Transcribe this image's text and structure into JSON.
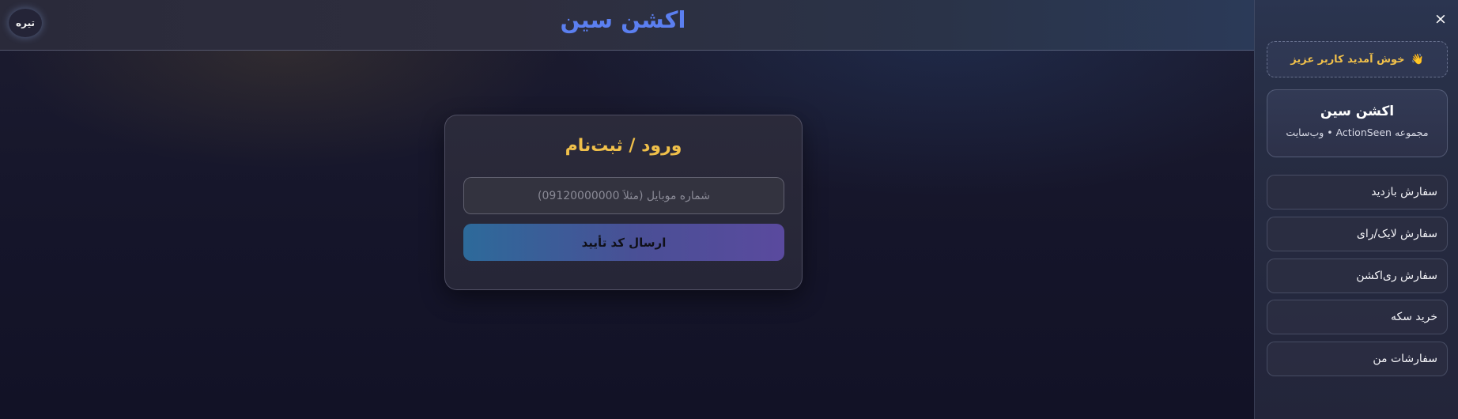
{
  "header": {
    "site_title": "اکشن سین",
    "theme_toggle_label": "تیره"
  },
  "login": {
    "title": "ورود / ثبت‌نام",
    "phone_placeholder": "شماره موبایل (مثلاً 09120000000)",
    "phone_value": "",
    "submit_label": "ارسال کد تأیید"
  },
  "sidebar": {
    "close_icon": "×",
    "welcome_emoji": "👋",
    "welcome_text": "خوش آمدید کاربر عزیز",
    "brand_name": "اکشن سین",
    "brand_subtitle": "مجموعه ActionSeen • وب‌سایت",
    "items": [
      {
        "label": "سفارش بازدید"
      },
      {
        "label": "سفارش لایک/رای"
      },
      {
        "label": "سفارش ری‌اکشن"
      },
      {
        "label": "خرید سکه"
      },
      {
        "label": "سفارشات من"
      }
    ]
  },
  "colors": {
    "accent_blue": "#5b7ff0",
    "accent_gold": "#f0c04a"
  }
}
